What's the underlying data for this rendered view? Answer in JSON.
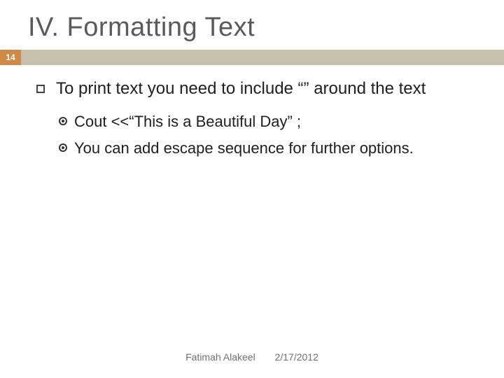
{
  "slide": {
    "title": "IV. Formatting Text",
    "page_number": "14",
    "main_bullet": "To print text you need to include “” around the text",
    "sub_bullets": [
      "Cout <<“This is a Beautiful Day” ;",
      "You can add escape sequence for further options."
    ],
    "footer": {
      "author": "Fatimah Alakeel",
      "date": "2/17/2012"
    }
  }
}
